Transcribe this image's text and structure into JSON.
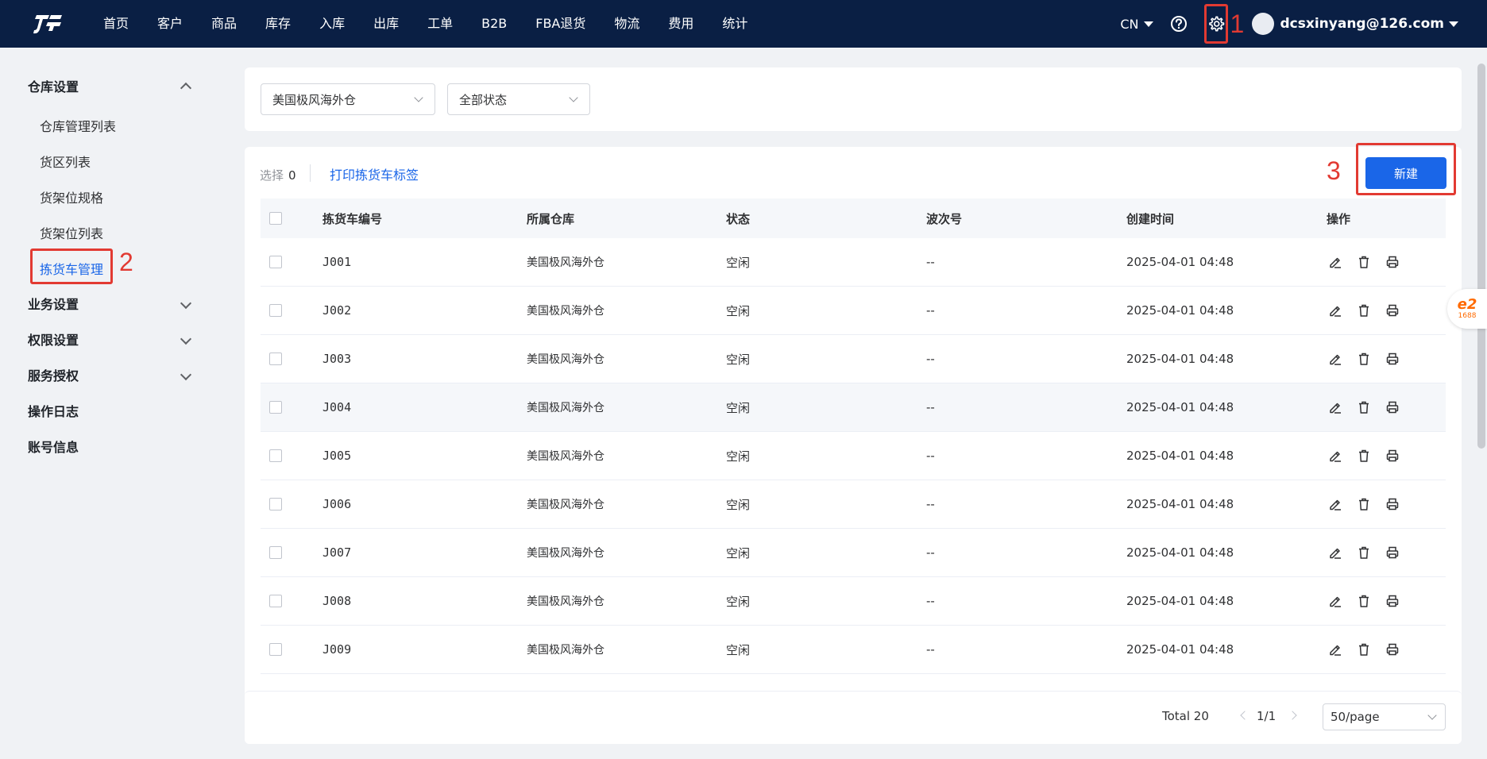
{
  "nav": {
    "items": [
      "首页",
      "客户",
      "商品",
      "库存",
      "入库",
      "出库",
      "工单",
      "B2B",
      "FBA退货",
      "物流",
      "费用",
      "统计"
    ],
    "lang": "CN",
    "user_email": "dcsxinyang@126.com"
  },
  "annotations": {
    "one": "1",
    "two": "2",
    "three": "3"
  },
  "sidebar": {
    "group_warehouse": "仓库设置",
    "sub_items": [
      "仓库管理列表",
      "货区列表",
      "货架位规格",
      "货架位列表",
      "拣货车管理"
    ],
    "group_business": "业务设置",
    "group_permission": "权限设置",
    "group_service": "服务授权",
    "item_oplog": "操作日志",
    "item_account": "账号信息"
  },
  "filters": {
    "warehouse": "美国极风海外仓",
    "status": "全部状态"
  },
  "toolbar": {
    "selected_label": "选择",
    "selected_count": "0",
    "print_label": "打印拣货车标签",
    "new_label": "新建"
  },
  "table": {
    "headers": {
      "id": "拣货车编号",
      "warehouse": "所属仓库",
      "status": "状态",
      "wave": "波次号",
      "created": "创建时间",
      "ops": "操作"
    },
    "rows": [
      {
        "id": "J001",
        "warehouse": "美国极风海外仓",
        "status": "空闲",
        "wave": "--",
        "created": "2025-04-01 04:48"
      },
      {
        "id": "J002",
        "warehouse": "美国极风海外仓",
        "status": "空闲",
        "wave": "--",
        "created": "2025-04-01 04:48"
      },
      {
        "id": "J003",
        "warehouse": "美国极风海外仓",
        "status": "空闲",
        "wave": "--",
        "created": "2025-04-01 04:48"
      },
      {
        "id": "J004",
        "warehouse": "美国极风海外仓",
        "status": "空闲",
        "wave": "--",
        "created": "2025-04-01 04:48"
      },
      {
        "id": "J005",
        "warehouse": "美国极风海外仓",
        "status": "空闲",
        "wave": "--",
        "created": "2025-04-01 04:48"
      },
      {
        "id": "J006",
        "warehouse": "美国极风海外仓",
        "status": "空闲",
        "wave": "--",
        "created": "2025-04-01 04:48"
      },
      {
        "id": "J007",
        "warehouse": "美国极风海外仓",
        "status": "空闲",
        "wave": "--",
        "created": "2025-04-01 04:48"
      },
      {
        "id": "J008",
        "warehouse": "美国极风海外仓",
        "status": "空闲",
        "wave": "--",
        "created": "2025-04-01 04:48"
      },
      {
        "id": "J009",
        "warehouse": "美国极风海外仓",
        "status": "空闲",
        "wave": "--",
        "created": "2025-04-01 04:48"
      }
    ]
  },
  "pager": {
    "total": "Total 20",
    "page": "1/1",
    "size": "50/page"
  },
  "badge": {
    "logo": "e2",
    "num": "1688"
  },
  "colors": {
    "topbar": "#0a1f44",
    "primary": "#1a66e8",
    "annotation": "#e23a32"
  },
  "icons": [
    "logo-icon",
    "help-icon",
    "gear-icon",
    "edit-icon",
    "delete-icon",
    "print-icon"
  ]
}
